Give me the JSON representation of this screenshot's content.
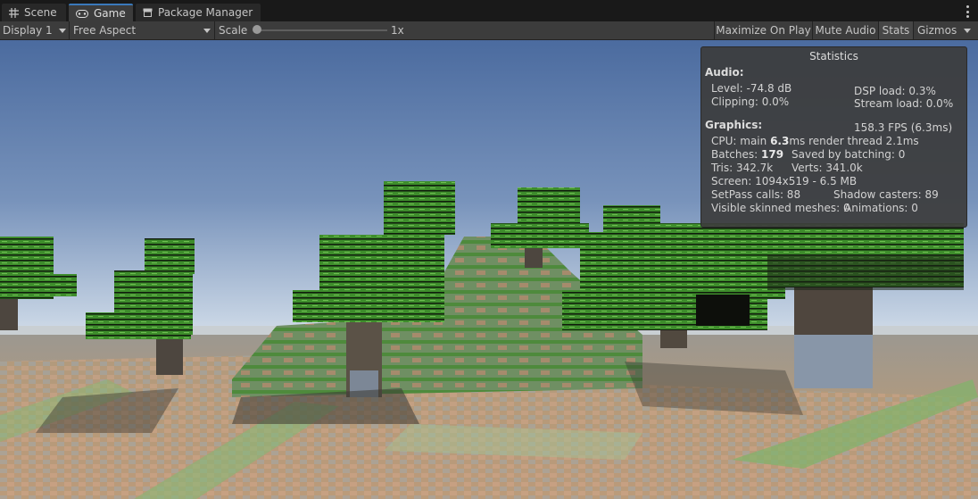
{
  "tabs": [
    {
      "label": "Scene",
      "icon": "grid-icon"
    },
    {
      "label": "Game",
      "icon": "gamepad-icon"
    },
    {
      "label": "Package Manager",
      "icon": "package-icon"
    }
  ],
  "toolbar": {
    "display": "Display 1",
    "aspect": "Free Aspect",
    "scale_label": "Scale",
    "scale_value": "1x",
    "scale_fraction": 0.0,
    "maximize_on_play": "Maximize On Play",
    "mute_audio": "Mute Audio",
    "stats": "Stats",
    "gizmos": "Gizmos"
  },
  "stats": {
    "title": "Statistics",
    "audio_header": "Audio:",
    "level": "Level: -74.8 dB",
    "clipping": "Clipping: 0.0%",
    "dsp_load": "DSP load: 0.3%",
    "stream_load": "Stream load: 0.0%",
    "graphics_header": "Graphics:",
    "fps": "158.3 FPS (6.3ms)",
    "cpu_prefix": "CPU: main ",
    "cpu_main": "6.3",
    "cpu_suffix": "ms  render thread 2.1ms",
    "batches_prefix": "Batches: ",
    "batches": "179",
    "saved_by_batching": "Saved by batching: 0",
    "tris": "Tris: 342.7k",
    "verts": "Verts: 341.0k",
    "screen": "Screen: 1094x519 - 6.5 MB",
    "setpass": "SetPass calls: 88",
    "shadow_casters": "Shadow casters: 89",
    "visible_skinned": "Visible skinned meshes: 0",
    "animations": "Animations: 0"
  },
  "colors": {
    "accent": "#3a79bb",
    "sky_top": "#4f6fa3",
    "sky_horizon": "#dfe6ee",
    "leaf": "#3f8a2e",
    "ground": "#b89a78"
  }
}
